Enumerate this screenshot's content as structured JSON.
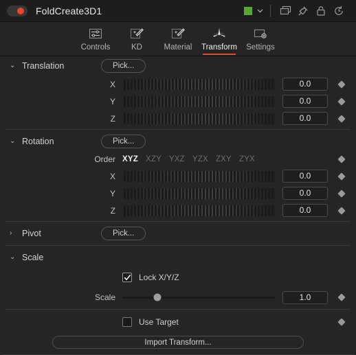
{
  "titlebar": {
    "node_name": "FoldCreate3D1",
    "enable_toggle_name": "node-enable-toggle",
    "color_swatch": "#5aa635",
    "icons": [
      "color-swatch",
      "chevron-down-icon",
      "duplicate-icon",
      "pin-icon",
      "lock-icon",
      "reset-icon"
    ]
  },
  "tabs": [
    {
      "label": "Controls",
      "icon": "sliders-icon",
      "active": false
    },
    {
      "label": "KD",
      "icon": "wand-icon",
      "active": false
    },
    {
      "label": "Material",
      "icon": "wand-icon",
      "active": false
    },
    {
      "label": "Transform",
      "icon": "transform-axis-icon",
      "active": true
    },
    {
      "label": "Settings",
      "icon": "settings-screen-icon",
      "active": false
    }
  ],
  "accent_color": "#e04b35",
  "sections": {
    "translation": {
      "title": "Translation",
      "expanded": true,
      "arrow": "⌄",
      "pick_label": "Pick...",
      "rows": [
        {
          "label": "X",
          "value": "0.0"
        },
        {
          "label": "Y",
          "value": "0.0"
        },
        {
          "label": "Z",
          "value": "0.0"
        }
      ]
    },
    "rotation": {
      "title": "Rotation",
      "expanded": true,
      "arrow": "⌄",
      "pick_label": "Pick...",
      "order_label": "Order",
      "order_options": [
        "XYZ",
        "XZY",
        "YXZ",
        "YZX",
        "ZXY",
        "ZYX"
      ],
      "order_selected": "XYZ",
      "rows": [
        {
          "label": "X",
          "value": "0.0"
        },
        {
          "label": "Y",
          "value": "0.0"
        },
        {
          "label": "Z",
          "value": "0.0"
        }
      ]
    },
    "pivot": {
      "title": "Pivot",
      "expanded": false,
      "arrow": "›",
      "pick_label": "Pick..."
    },
    "scale": {
      "title": "Scale",
      "expanded": true,
      "arrow": "⌄",
      "lock_label": "Lock X/Y/Z",
      "lock_checked": true,
      "scale_label": "Scale",
      "scale_value": "1.0",
      "scale_percent": 23
    },
    "target": {
      "use_target_label": "Use Target",
      "use_target_checked": false,
      "import_label": "Import Transform..."
    }
  }
}
